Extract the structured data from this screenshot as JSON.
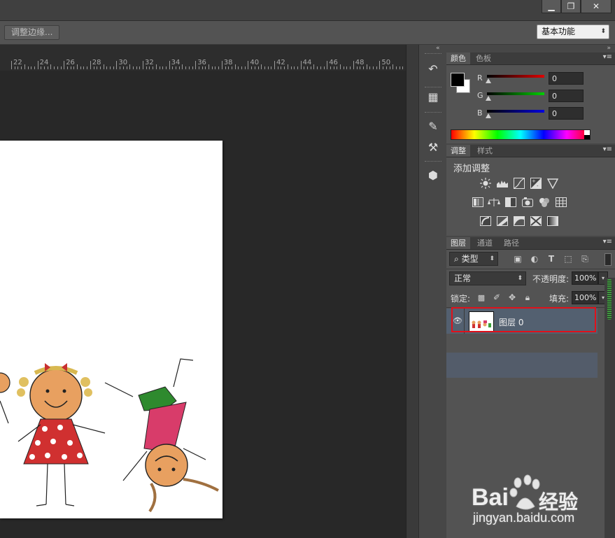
{
  "window": {
    "controls": [
      "▁",
      "❐",
      "✕"
    ]
  },
  "options_bar": {
    "refine_edge_label": "调整边缘...",
    "workspace_label": "基本功能"
  },
  "ruler": {
    "labels": [
      "22",
      "24",
      "26",
      "28",
      "30",
      "32",
      "34",
      "36",
      "38",
      "40",
      "42",
      "44",
      "46",
      "48",
      "50"
    ]
  },
  "color_panel": {
    "tabs": [
      "颜色",
      "色板"
    ],
    "channels": [
      {
        "label": "R",
        "value": "0",
        "color": "#c00000"
      },
      {
        "label": "G",
        "value": "0",
        "color": "#00b000"
      },
      {
        "label": "B",
        "value": "0",
        "color": "#0000c8"
      }
    ],
    "foreground": "#000000",
    "background": "#ffffff"
  },
  "adjustments_panel": {
    "tabs": [
      "调整",
      "样式"
    ],
    "heading": "添加调整"
  },
  "layers_panel": {
    "tabs": [
      "图层",
      "通道",
      "路径"
    ],
    "filter_label": "类型",
    "blend_mode": "正常",
    "opacity_label": "不透明度:",
    "opacity_value": "100%",
    "lock_label": "锁定:",
    "fill_label": "填充:",
    "fill_value": "100%",
    "layers": [
      {
        "name": "图层 0",
        "visible": true,
        "selected": true
      }
    ],
    "highlight_color": "#e0111a"
  },
  "watermark": {
    "brand": "Bai",
    "brand_suffix": "经验",
    "url": "jingyan.baidu.com"
  }
}
